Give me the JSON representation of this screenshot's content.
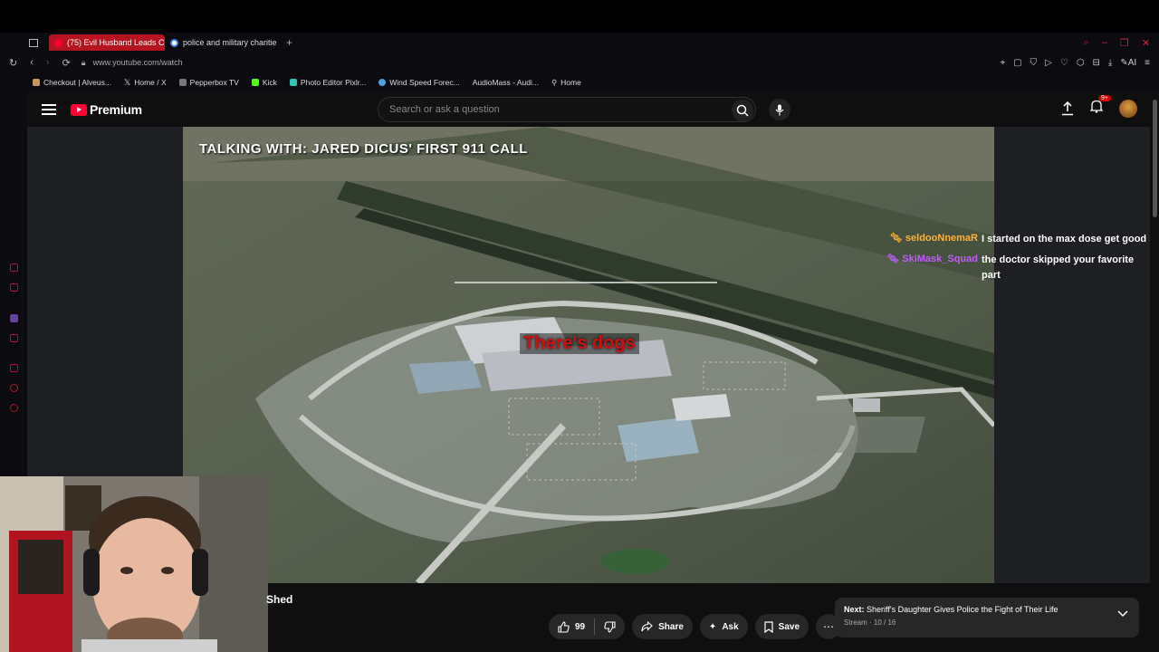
{
  "browser": {
    "tabs": [
      {
        "title": "(75) Evil Husband Leads Co",
        "active": true
      },
      {
        "title": "police and military charitie",
        "active": false
      }
    ],
    "url": "www.youtube.com/watch",
    "bookmarks": [
      "Checkout | Alveus...",
      "Home / X",
      "Pepperbox TV",
      "Kick",
      "Photo Editor Pixlr...",
      "Wind Speed Forec...",
      "AudioMass - Audi...",
      "Home"
    ],
    "accent_color": "#b3141f"
  },
  "youtube": {
    "logo_text": "Premium",
    "search_placeholder": "Search or ask a question",
    "notification_badge": "9+"
  },
  "video": {
    "overlay_title": "TALKING WITH: JARED DICUS' FIRST 911 CALL",
    "caption": "There's dogs",
    "chat": [
      {
        "user": "seldooNnemaR",
        "message": "I started on the max dose get good",
        "color": "#ffb13b"
      },
      {
        "user": "SkiMask_Squad",
        "message": "the doctor skipped your favorite part",
        "color": "#c05cff"
      }
    ]
  },
  "below_player": {
    "title_fragment": "Shed",
    "like_count": "99",
    "share_label": "Share",
    "ask_label": "Ask",
    "save_label": "Save"
  },
  "next_up": {
    "prefix": "Next:",
    "title": "Sheriff's Daughter Gives Police the Fight of Their Life",
    "sub": "Stream · 10 / 16"
  }
}
